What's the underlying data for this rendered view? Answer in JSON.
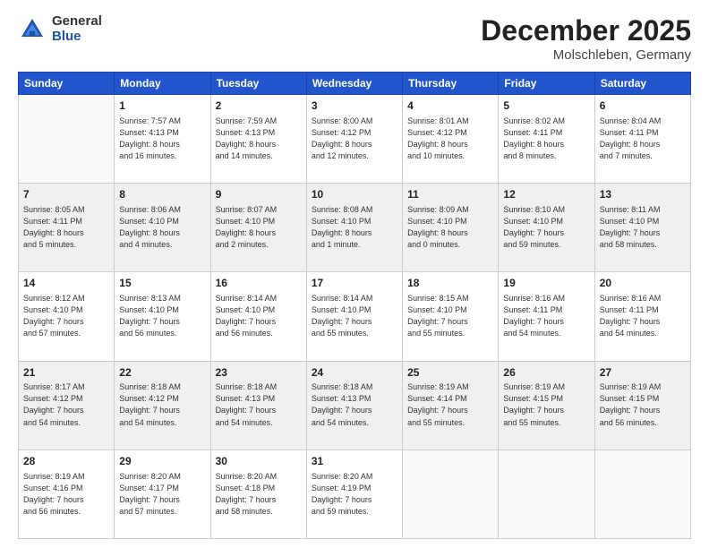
{
  "logo": {
    "general": "General",
    "blue": "Blue"
  },
  "header": {
    "month": "December 2025",
    "location": "Molschleben, Germany"
  },
  "weekdays": [
    "Sunday",
    "Monday",
    "Tuesday",
    "Wednesday",
    "Thursday",
    "Friday",
    "Saturday"
  ],
  "weeks": [
    [
      {
        "day": "",
        "info": ""
      },
      {
        "day": "1",
        "info": "Sunrise: 7:57 AM\nSunset: 4:13 PM\nDaylight: 8 hours\nand 16 minutes."
      },
      {
        "day": "2",
        "info": "Sunrise: 7:59 AM\nSunset: 4:13 PM\nDaylight: 8 hours\nand 14 minutes."
      },
      {
        "day": "3",
        "info": "Sunrise: 8:00 AM\nSunset: 4:12 PM\nDaylight: 8 hours\nand 12 minutes."
      },
      {
        "day": "4",
        "info": "Sunrise: 8:01 AM\nSunset: 4:12 PM\nDaylight: 8 hours\nand 10 minutes."
      },
      {
        "day": "5",
        "info": "Sunrise: 8:02 AM\nSunset: 4:11 PM\nDaylight: 8 hours\nand 8 minutes."
      },
      {
        "day": "6",
        "info": "Sunrise: 8:04 AM\nSunset: 4:11 PM\nDaylight: 8 hours\nand 7 minutes."
      }
    ],
    [
      {
        "day": "7",
        "info": "Sunrise: 8:05 AM\nSunset: 4:11 PM\nDaylight: 8 hours\nand 5 minutes."
      },
      {
        "day": "8",
        "info": "Sunrise: 8:06 AM\nSunset: 4:10 PM\nDaylight: 8 hours\nand 4 minutes."
      },
      {
        "day": "9",
        "info": "Sunrise: 8:07 AM\nSunset: 4:10 PM\nDaylight: 8 hours\nand 2 minutes."
      },
      {
        "day": "10",
        "info": "Sunrise: 8:08 AM\nSunset: 4:10 PM\nDaylight: 8 hours\nand 1 minute."
      },
      {
        "day": "11",
        "info": "Sunrise: 8:09 AM\nSunset: 4:10 PM\nDaylight: 8 hours\nand 0 minutes."
      },
      {
        "day": "12",
        "info": "Sunrise: 8:10 AM\nSunset: 4:10 PM\nDaylight: 7 hours\nand 59 minutes."
      },
      {
        "day": "13",
        "info": "Sunrise: 8:11 AM\nSunset: 4:10 PM\nDaylight: 7 hours\nand 58 minutes."
      }
    ],
    [
      {
        "day": "14",
        "info": "Sunrise: 8:12 AM\nSunset: 4:10 PM\nDaylight: 7 hours\nand 57 minutes."
      },
      {
        "day": "15",
        "info": "Sunrise: 8:13 AM\nSunset: 4:10 PM\nDaylight: 7 hours\nand 56 minutes."
      },
      {
        "day": "16",
        "info": "Sunrise: 8:14 AM\nSunset: 4:10 PM\nDaylight: 7 hours\nand 56 minutes."
      },
      {
        "day": "17",
        "info": "Sunrise: 8:14 AM\nSunset: 4:10 PM\nDaylight: 7 hours\nand 55 minutes."
      },
      {
        "day": "18",
        "info": "Sunrise: 8:15 AM\nSunset: 4:10 PM\nDaylight: 7 hours\nand 55 minutes."
      },
      {
        "day": "19",
        "info": "Sunrise: 8:16 AM\nSunset: 4:11 PM\nDaylight: 7 hours\nand 54 minutes."
      },
      {
        "day": "20",
        "info": "Sunrise: 8:16 AM\nSunset: 4:11 PM\nDaylight: 7 hours\nand 54 minutes."
      }
    ],
    [
      {
        "day": "21",
        "info": "Sunrise: 8:17 AM\nSunset: 4:12 PM\nDaylight: 7 hours\nand 54 minutes."
      },
      {
        "day": "22",
        "info": "Sunrise: 8:18 AM\nSunset: 4:12 PM\nDaylight: 7 hours\nand 54 minutes."
      },
      {
        "day": "23",
        "info": "Sunrise: 8:18 AM\nSunset: 4:13 PM\nDaylight: 7 hours\nand 54 minutes."
      },
      {
        "day": "24",
        "info": "Sunrise: 8:18 AM\nSunset: 4:13 PM\nDaylight: 7 hours\nand 54 minutes."
      },
      {
        "day": "25",
        "info": "Sunrise: 8:19 AM\nSunset: 4:14 PM\nDaylight: 7 hours\nand 55 minutes."
      },
      {
        "day": "26",
        "info": "Sunrise: 8:19 AM\nSunset: 4:15 PM\nDaylight: 7 hours\nand 55 minutes."
      },
      {
        "day": "27",
        "info": "Sunrise: 8:19 AM\nSunset: 4:15 PM\nDaylight: 7 hours\nand 56 minutes."
      }
    ],
    [
      {
        "day": "28",
        "info": "Sunrise: 8:19 AM\nSunset: 4:16 PM\nDaylight: 7 hours\nand 56 minutes."
      },
      {
        "day": "29",
        "info": "Sunrise: 8:20 AM\nSunset: 4:17 PM\nDaylight: 7 hours\nand 57 minutes."
      },
      {
        "day": "30",
        "info": "Sunrise: 8:20 AM\nSunset: 4:18 PM\nDaylight: 7 hours\nand 58 minutes."
      },
      {
        "day": "31",
        "info": "Sunrise: 8:20 AM\nSunset: 4:19 PM\nDaylight: 7 hours\nand 59 minutes."
      },
      {
        "day": "",
        "info": ""
      },
      {
        "day": "",
        "info": ""
      },
      {
        "day": "",
        "info": ""
      }
    ]
  ]
}
